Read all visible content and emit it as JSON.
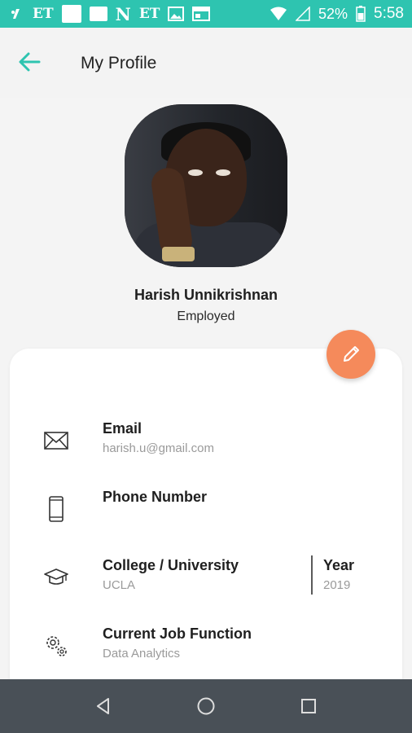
{
  "status_bar": {
    "battery_percent": "52%",
    "time": "5:58",
    "et1": "ET",
    "et2": "ET",
    "n": "N"
  },
  "header": {
    "title": "My Profile"
  },
  "profile": {
    "name": "Harish Unnikrishnan",
    "status": "Employed"
  },
  "fields": {
    "email": {
      "label": "Email",
      "value": "harish.u@gmail.com"
    },
    "phone": {
      "label": "Phone Number",
      "value": ""
    },
    "college": {
      "label": "College / University",
      "value": "UCLA"
    },
    "year": {
      "label": "Year",
      "value": "2019"
    },
    "job": {
      "label": "Current Job Function",
      "value": "Data Analytics"
    }
  },
  "colors": {
    "status_bar": "#2ec4b0",
    "accent": "#2ec4b0",
    "fab": "#f58a5b",
    "nav_bar": "#495057"
  },
  "icons": {
    "back": "arrow-left-icon",
    "edit": "pencil-icon",
    "email": "envelope-icon",
    "phone": "smartphone-icon",
    "college": "graduation-cap-icon",
    "job": "gears-icon"
  }
}
